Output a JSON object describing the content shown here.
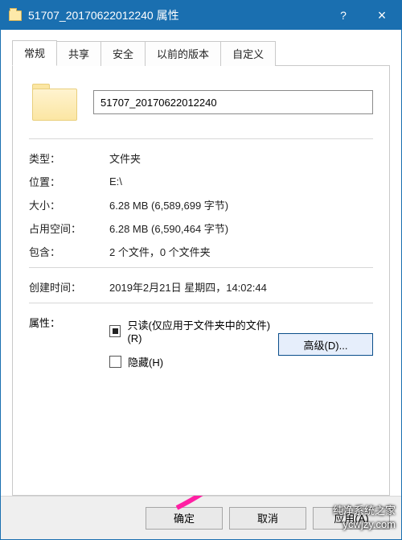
{
  "titlebar": {
    "title": "51707_20170622012240 属性"
  },
  "tabs": {
    "active": "常规",
    "items": [
      "常规",
      "共享",
      "安全",
      "以前的版本",
      "自定义"
    ]
  },
  "general": {
    "name_value": "51707_20170622012240",
    "type_label": "类型：",
    "type_value": "文件夹",
    "location_label": "位置：",
    "location_value": "E:\\",
    "size_label": "大小：",
    "size_value": "6.28 MB (6,589,699 字节)",
    "size_on_disk_label": "占用空间：",
    "size_on_disk_value": "6.28 MB (6,590,464 字节)",
    "contains_label": "包含：",
    "contains_value": "2 个文件，0 个文件夹",
    "created_label": "创建时间：",
    "created_value": "2019年2月21日 星期四，14:02:44",
    "attributes_label": "属性：",
    "readonly_label": "只读(仅应用于文件夹中的文件)(R)",
    "hidden_label": "隐藏(H)",
    "advanced_label": "高级(D)..."
  },
  "footer": {
    "ok": "确定",
    "cancel": "取消",
    "apply": "应用(A)"
  },
  "watermark": {
    "line1": "纯净系统之家",
    "line2": "ycwjzy.com"
  }
}
